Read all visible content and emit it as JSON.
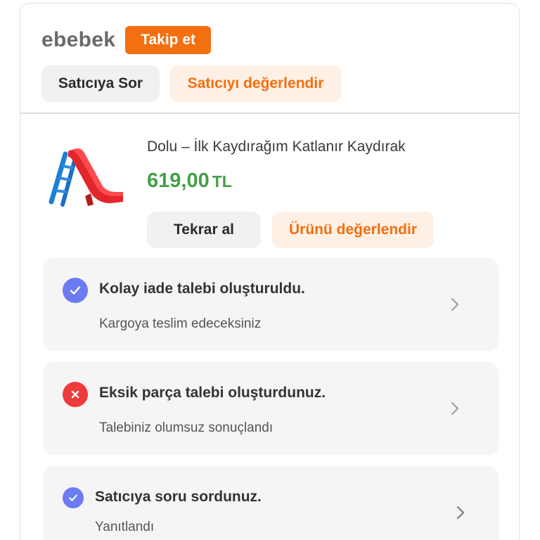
{
  "seller": {
    "name": "ebebek",
    "follow_label": "Takip et",
    "ask_label": "Satıcıya Sor",
    "rate_label": "Satıcıyı değerlendir"
  },
  "product": {
    "title": "Dolu – İlk Kaydırağım Katlanır Kaydırak",
    "price": "619,00",
    "currency": "TL",
    "buy_again_label": "Tekrar al",
    "rate_label": "Ürünü değerlendir",
    "image_icon": "slide-toy-image"
  },
  "statuses": [
    {
      "title": "Kolay iade talebi oluşturuldu.",
      "subtitle": "Kargoya teslim edeceksiniz",
      "icon": "check-icon"
    },
    {
      "title": "Eksik parça talebi oluşturdunuz.",
      "subtitle": "Talebiniz olumsuz sonuçlandı",
      "icon": "x-icon"
    },
    {
      "title": "Satıcıya soru sordunuz.",
      "subtitle": "Yanıtlandı",
      "icon": "check-icon"
    }
  ],
  "colors": {
    "accent": "#f36f0f",
    "accent_soft": "#fff0e6",
    "price": "#43a047",
    "success_icon": "#6c7bf2",
    "error_icon": "#ee3b3b"
  }
}
